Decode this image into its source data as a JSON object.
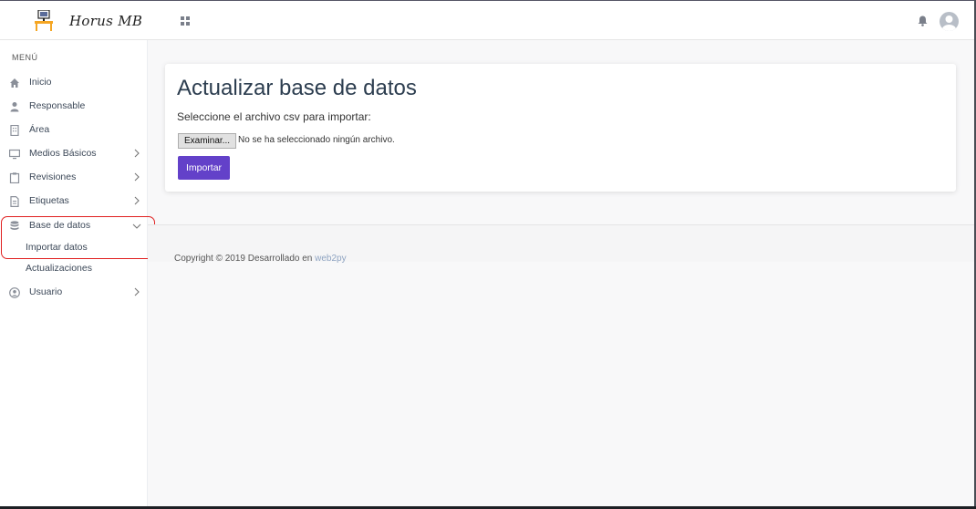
{
  "header": {
    "brand": "Horus MB"
  },
  "sidebar": {
    "menu_title": "MENÚ",
    "items": [
      {
        "label": "Inicio",
        "icon": "home-icon"
      },
      {
        "label": "Responsable",
        "icon": "user-icon"
      },
      {
        "label": "Área",
        "icon": "building-icon"
      },
      {
        "label": "Medios Básicos",
        "icon": "monitor-icon"
      },
      {
        "label": "Revisiones",
        "icon": "clipboard-icon"
      },
      {
        "label": "Etiquetas",
        "icon": "document-icon"
      },
      {
        "label": "Base de datos",
        "icon": "database-icon"
      },
      {
        "label": "Usuario",
        "icon": "user-circle-icon"
      }
    ],
    "sub_items": [
      "Importar datos",
      "Actualizaciones"
    ]
  },
  "main": {
    "title": "Actualizar base de datos",
    "subtitle": "Seleccione el archivo csv para importar:",
    "browse_label": "Examinar...",
    "file_status": "No se ha seleccionado ningún archivo.",
    "import_label": "Importar"
  },
  "footer": {
    "text": "Copyright © 2019 Desarrollado en",
    "link": "web2py"
  },
  "colors": {
    "accent": "#6341c9",
    "highlight": "#e02020",
    "link": "#8fa4c2"
  }
}
